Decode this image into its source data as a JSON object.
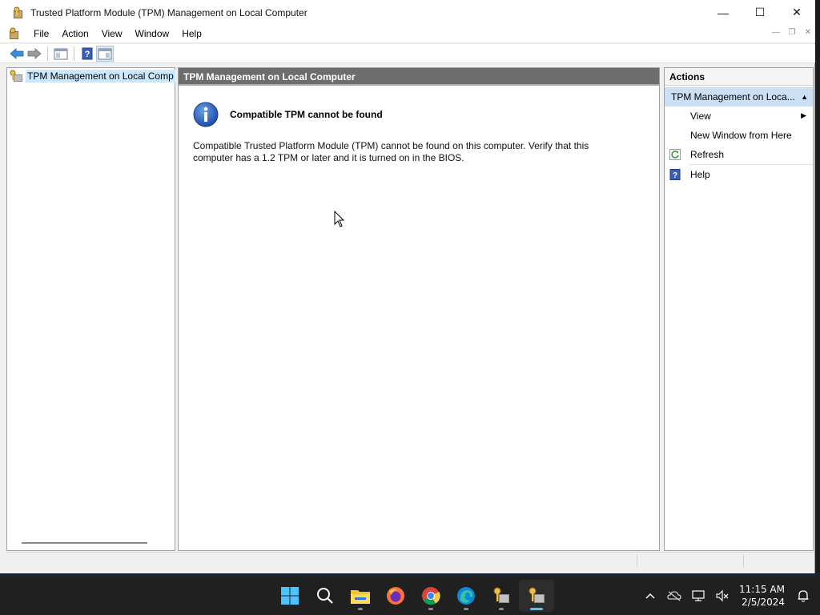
{
  "window": {
    "title": "Trusted Platform Module (TPM) Management on Local Computer",
    "controls": {
      "minimize": "—",
      "maximize": "☐",
      "close": "✕"
    }
  },
  "menubar": {
    "items": [
      "File",
      "Action",
      "View",
      "Window",
      "Help"
    ],
    "mdi": {
      "minimize": "—",
      "restore": "❐",
      "close": "✕"
    }
  },
  "toolbar": {
    "buttons": [
      "back-arrow-icon",
      "forward-arrow-icon",
      "show-hide-console-tree-icon",
      "help-icon",
      "show-hide-action-pane-icon"
    ]
  },
  "tree": {
    "root_label": "TPM Management on Local Comp"
  },
  "center": {
    "header": "TPM Management on Local Computer",
    "message_title": "Compatible TPM cannot be found",
    "message_body": "Compatible Trusted Platform Module (TPM) cannot be found on this computer. Verify that this computer has a 1.2 TPM or later and it is turned on in the BIOS."
  },
  "actions": {
    "header": "Actions",
    "section_title": "TPM Management on Loca...",
    "items": [
      {
        "label": "View",
        "icon": "",
        "submenu": true
      },
      {
        "label": "New Window from Here",
        "icon": "",
        "submenu": false
      },
      {
        "label": "Refresh",
        "icon": "refresh-icon",
        "submenu": false
      },
      {
        "label": "Help",
        "icon": "help-icon",
        "submenu": false
      }
    ]
  },
  "taskbar": {
    "apps": [
      "start-icon",
      "search-icon",
      "file-explorer-icon",
      "firefox-icon",
      "chrome-icon",
      "edge-icon",
      "tpm-app-icon",
      "tpm-app-active-icon"
    ],
    "tray": [
      "chevron-up-icon",
      "onedrive-icon",
      "network-icon",
      "volume-muted-icon"
    ],
    "clock_time": "11:15 AM",
    "clock_date": "2/5/2024",
    "notification_icon": "bell-icon"
  },
  "colors": {
    "selection": "#cce8ff",
    "center_header": "#6d6d6d",
    "actions_section": "#cce0f5",
    "taskbar": "#202020",
    "accent": "#4cc2ff"
  }
}
